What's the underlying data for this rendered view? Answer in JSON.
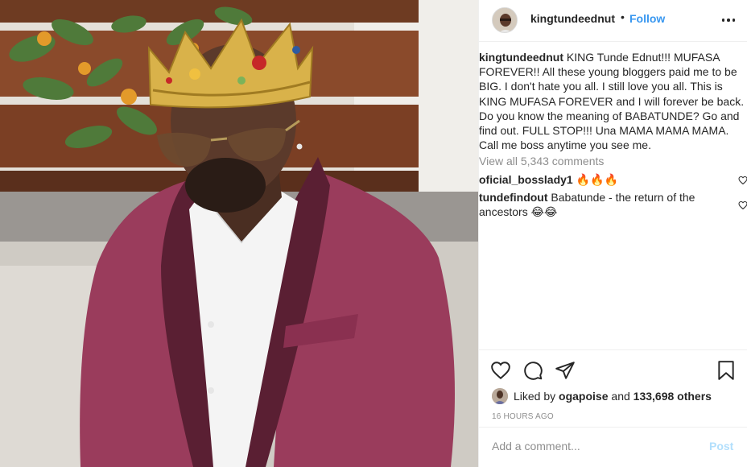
{
  "post": {
    "photo_alt": "Man in maroon tuxedo jacket wearing a gold crown and sunglasses"
  },
  "header": {
    "username": "kingtundeednut",
    "dot": "•",
    "follow_label": "Follow"
  },
  "caption": {
    "username": "kingtundeednut",
    "text": "KING Tunde Ednut!!! MUFASA FOREVER!! All these young bloggers paid me to be BIG. I don't hate you all. I still love you all. This is KING MUFASA FOREVER and I will forever be back. Do you know the meaning of BABATUNDE? Go and find out. FULL STOP!!! Una MAMA MAMA MAMA. Call me boss anytime you see me."
  },
  "view_all_comments": "View all 5,343 comments",
  "comments": [
    {
      "username": "oficial_bosslady1",
      "text": "🔥🔥🔥"
    },
    {
      "username": "tundefindout",
      "text": "Babatunde - the return of the ancestors 😂😂"
    }
  ],
  "likes": {
    "prefix": "Liked by",
    "user": "ogapoise",
    "middle": "and",
    "count": "133,698 others"
  },
  "timestamp": "16 HOURS AGO",
  "add_comment": {
    "placeholder": "Add a comment...",
    "post_label": "Post"
  },
  "colors": {
    "link_blue": "#3897f0",
    "post_disabled": "#b2dffc",
    "muted_text": "#8e8e8e",
    "jacket_maroon": "#9a3c5c",
    "crown_gold": "#d9b24a"
  }
}
